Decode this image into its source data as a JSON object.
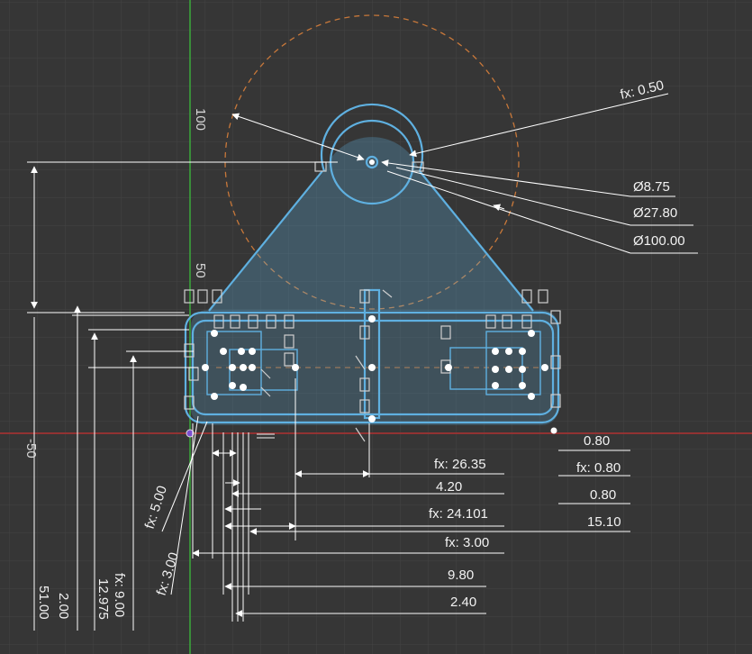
{
  "viewport": {
    "grid_color": "#454545",
    "x_axis_color": "#b03030",
    "y_axis_color": "#3aa83a",
    "sketch_color": "#5fb0e0",
    "construction_color": "#c8783a",
    "dimension_color": "#ffffff",
    "constraint_icons": "constraint-glyph"
  },
  "ruler": {
    "y100": "100",
    "y50": "50",
    "ym50": "-50"
  },
  "dimensions": {
    "fx050": "fx: 0.50",
    "d875": "Ø8.75",
    "d2780": "Ø27.80",
    "d10000": "Ø100.00",
    "v080_a": "0.80",
    "fx2635": "fx: 26.35",
    "fx080": "fx: 0.80",
    "v420": "4.20",
    "v080_b": "0.80",
    "fx24101": "fx: 24.101",
    "v1510": "15.10",
    "fx300_h": "fx: 3.00",
    "v980": "9.80",
    "v240": "2.40",
    "fx500": "fx: 5.00",
    "fx300_v": "fx: 3.00",
    "v5100": "51.00",
    "v200": "2.00",
    "v12975": "12.975",
    "fx900": "fx: 9.00"
  }
}
